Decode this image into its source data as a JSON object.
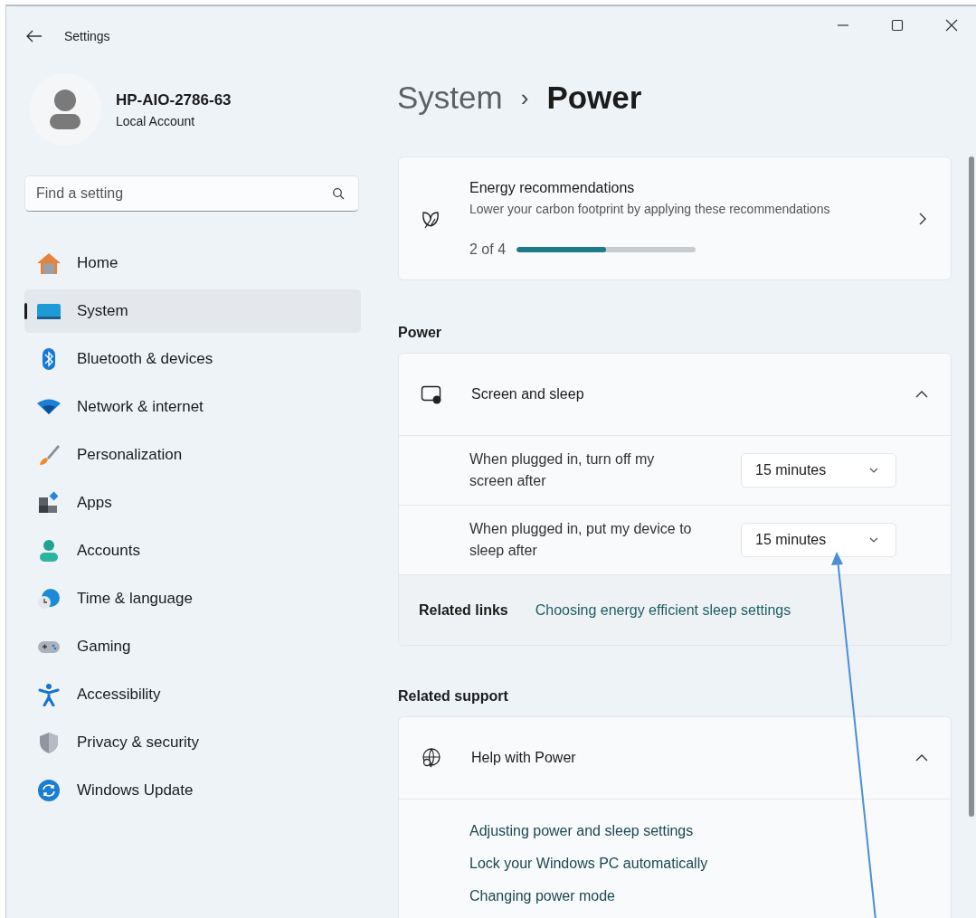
{
  "window": {
    "title": "Settings"
  },
  "account": {
    "name": "HP-AIO-2786-63",
    "type": "Local Account"
  },
  "search": {
    "placeholder": "Find a setting"
  },
  "sidebar": {
    "items": [
      {
        "label": "Home",
        "selected": false
      },
      {
        "label": "System",
        "selected": true
      },
      {
        "label": "Bluetooth & devices",
        "selected": false
      },
      {
        "label": "Network & internet",
        "selected": false
      },
      {
        "label": "Personalization",
        "selected": false
      },
      {
        "label": "Apps",
        "selected": false
      },
      {
        "label": "Accounts",
        "selected": false
      },
      {
        "label": "Time & language",
        "selected": false
      },
      {
        "label": "Gaming",
        "selected": false
      },
      {
        "label": "Accessibility",
        "selected": false
      },
      {
        "label": "Privacy & security",
        "selected": false
      },
      {
        "label": "Windows Update",
        "selected": false
      }
    ]
  },
  "breadcrumb": {
    "parent": "System",
    "separator": "›",
    "current": "Power"
  },
  "energy_card": {
    "title": "Energy recommendations",
    "description": "Lower your carbon footprint by applying these recommendations",
    "progress_text": "2 of 4",
    "level": 0.5
  },
  "power_section": {
    "heading": "Power",
    "group": {
      "title": "Screen and sleep",
      "expanded": true,
      "rows": [
        {
          "label": "When plugged in, turn off my screen after",
          "value": "15 minutes"
        },
        {
          "label": "When plugged in, put my device to sleep after",
          "value": "15 minutes"
        }
      ],
      "related_links": {
        "label": "Related links",
        "link": "Choosing energy efficient sleep settings"
      }
    }
  },
  "support_section": {
    "heading": "Related support",
    "group": {
      "title": "Help with Power",
      "expanded": true,
      "links": [
        "Adjusting power and sleep settings",
        "Lock your Windows PC automatically",
        "Changing power mode"
      ]
    }
  }
}
